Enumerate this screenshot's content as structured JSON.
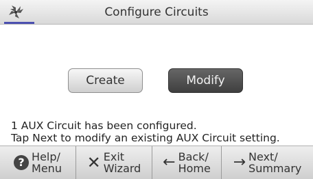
{
  "header": {
    "title": "Configure Circuits",
    "logo_icon": "pinwheel-logo-icon"
  },
  "actions": {
    "create_label": "Create",
    "modify_label": "Modify"
  },
  "message": {
    "line1": "1 AUX Circuit has been configured.",
    "line2": "Tap Next to modify an existing AUX Circuit setting."
  },
  "footer": {
    "help": {
      "line1": "Help/",
      "line2": "Menu",
      "icon": "help-icon"
    },
    "exit": {
      "line1": "Exit",
      "line2": "Wizard",
      "icon": "close-icon"
    },
    "back": {
      "line1": "Back/",
      "line2": "Home",
      "icon": "arrow-left-icon"
    },
    "next": {
      "line1": "Next/",
      "line2": "Summary",
      "icon": "arrow-right-icon"
    }
  }
}
